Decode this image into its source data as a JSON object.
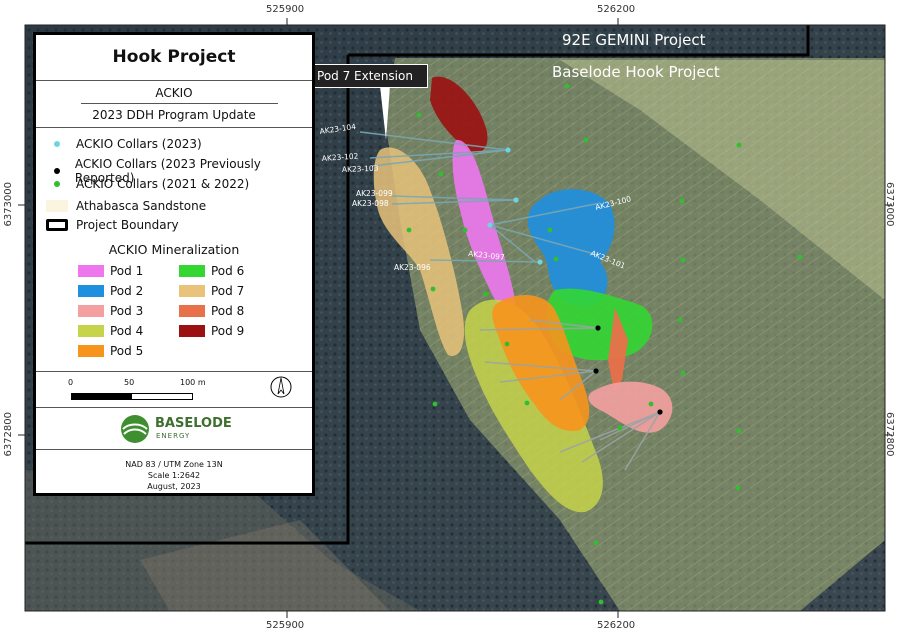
{
  "legend": {
    "title": "Hook Project",
    "subtitle": "ACKIO",
    "program": "2023 DDH Program Update",
    "symbols": [
      {
        "label": "ACKIO Collars (2023)",
        "color": "#6fd3e0"
      },
      {
        "label": "ACKIO Collars (2023 Previously Reported)",
        "color": "#000000"
      },
      {
        "label": "ACKIO Collars (2021 & 2022)",
        "color": "#2fbf2f"
      },
      {
        "label": "Athabasca Sandstone",
        "color": "#fbf5df"
      },
      {
        "label": "Project Boundary",
        "color": "#000000"
      }
    ],
    "mineralization_heading": "ACKIO Mineralization",
    "pods": [
      {
        "label": "Pod 1",
        "color": "#ee77ee"
      },
      {
        "label": "Pod 2",
        "color": "#1f8fe0"
      },
      {
        "label": "Pod 3",
        "color": "#f4a0a0"
      },
      {
        "label": "Pod 4",
        "color": "#c5d44a"
      },
      {
        "label": "Pod 5",
        "color": "#f7941d"
      },
      {
        "label": "Pod 6",
        "color": "#33d633"
      },
      {
        "label": "Pod 7",
        "color": "#e9c37a"
      },
      {
        "label": "Pod 8",
        "color": "#e8704a"
      },
      {
        "label": "Pod 9",
        "color": "#9b1010"
      }
    ],
    "scale_ticks": [
      "0",
      "50",
      "100 m"
    ],
    "logo_name": "BASELODE",
    "logo_sub": "ENERGY",
    "datum": "NAD 83 / UTM Zone 13N",
    "scale": "Scale 1:2642",
    "date": "August, 2023"
  },
  "map": {
    "labels": {
      "gemini": "92E GEMINI Project",
      "hook": "Baselode Hook Project",
      "callout": "Pod 7 Extension"
    },
    "easting_ticks": [
      "525900",
      "526200"
    ],
    "northing_ticks": [
      "6373000",
      "6372800"
    ],
    "holes": [
      "AK23-104",
      "AK23-102",
      "AK23-103",
      "AK23-099",
      "AK23-098",
      "AK23-100",
      "AK23-097",
      "AK23-101",
      "AK23-096"
    ]
  }
}
